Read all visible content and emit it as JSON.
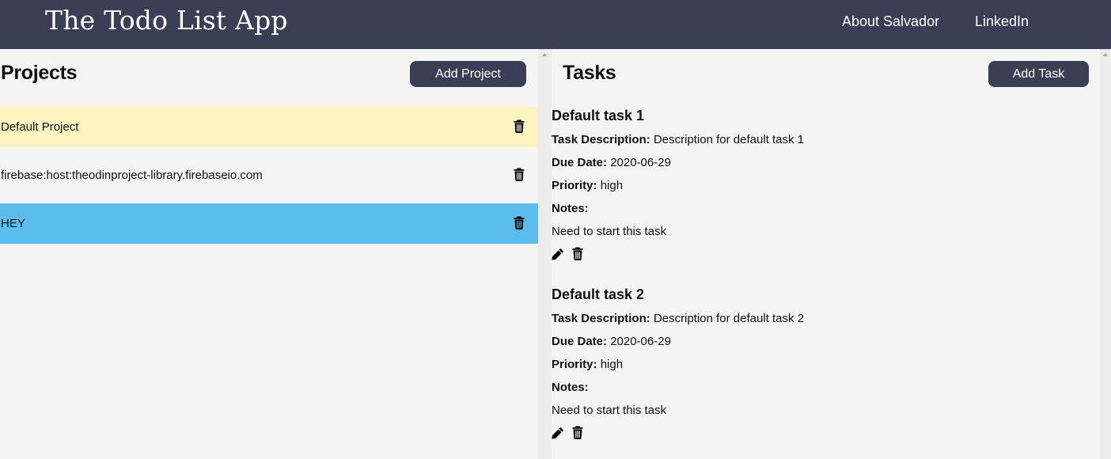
{
  "navbar": {
    "title": "The Todo List App",
    "links": [
      "About Salvador",
      "LinkedIn"
    ]
  },
  "projects": {
    "heading": "Projects",
    "add_label": "Add Project",
    "items": [
      {
        "name": "Default Project",
        "bg": "#fff3c0"
      },
      {
        "name": "firebase:host:theodinproject-library.firebaseio.com",
        "bg": "#f4f4f4"
      },
      {
        "name": "HEY",
        "bg": "#5bbdec"
      }
    ]
  },
  "tasks": {
    "heading": "Tasks",
    "add_label": "Add Task",
    "labels": {
      "description": "Task Description:",
      "due": "Due Date:",
      "priority": "Priority:",
      "notes": "Notes:"
    },
    "items": [
      {
        "title": "Default task 1",
        "description": "Description for default task 1",
        "due_date": "2020-06-29",
        "priority": "high",
        "notes": "Need to start this task"
      },
      {
        "title": "Default task 2",
        "description": "Description for default task 2",
        "due_date": "2020-06-29",
        "priority": "high",
        "notes": "Need to start this task"
      }
    ]
  },
  "colors": {
    "navbar": "#3a3f55",
    "selected_project": "#5bbdec",
    "default_project": "#fff3c0"
  },
  "icons": [
    "trash-icon",
    "pencil-icon"
  ]
}
